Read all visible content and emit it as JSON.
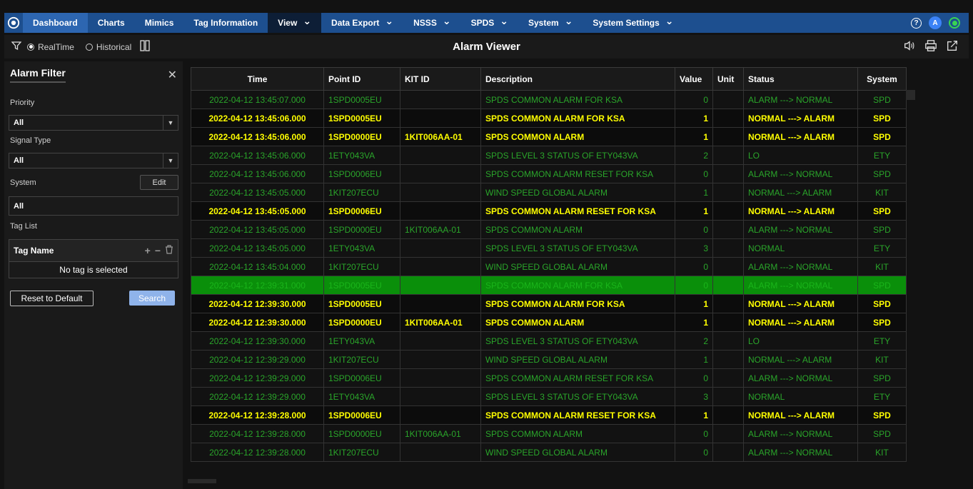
{
  "nav": {
    "items": [
      {
        "label": "Dashboard",
        "style": "active",
        "chevron": false
      },
      {
        "label": "Charts",
        "style": "",
        "chevron": false
      },
      {
        "label": "Mimics",
        "style": "",
        "chevron": false
      },
      {
        "label": "Tag Information",
        "style": "",
        "chevron": false
      },
      {
        "label": "View",
        "style": "dark",
        "chevron": true
      },
      {
        "label": "Data Export",
        "style": "",
        "chevron": true
      },
      {
        "label": "NSSS",
        "style": "",
        "chevron": true
      },
      {
        "label": "SPDS",
        "style": "",
        "chevron": true
      },
      {
        "label": "System",
        "style": "",
        "chevron": true
      },
      {
        "label": "System Settings",
        "style": "",
        "chevron": true
      }
    ],
    "avatar_letter": "A",
    "colors": {
      "bar": "#1d4f8f",
      "active": "#2d66b1",
      "status": "#39d353"
    }
  },
  "toolbar": {
    "realtime_label": "RealTime",
    "historical_label": "Historical",
    "title": "Alarm Viewer"
  },
  "filter": {
    "title": "Alarm Filter",
    "priority_label": "Priority",
    "priority_value": "All",
    "signal_type_label": "Signal Type",
    "signal_type_value": "All",
    "system_label": "System",
    "edit_label": "Edit",
    "system_value": "All",
    "tag_list_label": "Tag List",
    "tag_name_header": "Tag Name",
    "empty_text": "No tag is selected",
    "reset_label": "Reset to Default",
    "search_label": "Search"
  },
  "table": {
    "columns": [
      "Time",
      "Point ID",
      "KIT ID",
      "Description",
      "Value",
      "Unit",
      "Status",
      "System"
    ],
    "rows": [
      {
        "kind": "normal",
        "cells": [
          "2022-04-12 13:45:07.000",
          "1SPD0005EU",
          "",
          "SPDS COMMON ALARM FOR KSA",
          "0",
          "",
          "ALARM ---> NORMAL",
          "SPD"
        ]
      },
      {
        "kind": "alarm",
        "cells": [
          "2022-04-12 13:45:06.000",
          "1SPD0005EU",
          "",
          "SPDS COMMON ALARM FOR KSA",
          "1",
          "",
          "NORMAL ---> ALARM",
          "SPD"
        ]
      },
      {
        "kind": "alarm",
        "cells": [
          "2022-04-12 13:45:06.000",
          "1SPD0000EU",
          "1KIT006AA-01",
          "SPDS COMMON ALARM",
          "1",
          "",
          "NORMAL ---> ALARM",
          "SPD"
        ]
      },
      {
        "kind": "normal",
        "cells": [
          "2022-04-12 13:45:06.000",
          "1ETY043VA",
          "",
          "SPDS LEVEL 3 STATUS OF ETY043VA",
          "2",
          "",
          "LO",
          "ETY"
        ]
      },
      {
        "kind": "normal",
        "cells": [
          "2022-04-12 13:45:06.000",
          "1SPD0006EU",
          "",
          "SPDS COMMON ALARM RESET FOR KSA",
          "0",
          "",
          "ALARM ---> NORMAL",
          "SPD"
        ]
      },
      {
        "kind": "normal",
        "cells": [
          "2022-04-12 13:45:05.000",
          "1KIT207ECU",
          "",
          "WIND SPEED GLOBAL ALARM",
          "1",
          "",
          "NORMAL ---> ALARM",
          "KIT"
        ]
      },
      {
        "kind": "alarm",
        "cells": [
          "2022-04-12 13:45:05.000",
          "1SPD0006EU",
          "",
          "SPDS COMMON ALARM RESET FOR KSA",
          "1",
          "",
          "NORMAL ---> ALARM",
          "SPD"
        ]
      },
      {
        "kind": "normal",
        "cells": [
          "2022-04-12 13:45:05.000",
          "1SPD0000EU",
          "1KIT006AA-01",
          "SPDS COMMON ALARM",
          "0",
          "",
          "ALARM ---> NORMAL",
          "SPD"
        ]
      },
      {
        "kind": "normal",
        "cells": [
          "2022-04-12 13:45:05.000",
          "1ETY043VA",
          "",
          "SPDS LEVEL 3 STATUS OF ETY043VA",
          "3",
          "",
          "NORMAL",
          "ETY"
        ]
      },
      {
        "kind": "normal",
        "cells": [
          "2022-04-12 13:45:04.000",
          "1KIT207ECU",
          "",
          "WIND SPEED GLOBAL ALARM",
          "0",
          "",
          "ALARM ---> NORMAL",
          "KIT"
        ]
      },
      {
        "kind": "selected",
        "cells": [
          "2022-04-12 12:39:31.000",
          "1SPD0005EU",
          "",
          "SPDS COMMON ALARM FOR KSA",
          "0",
          "",
          "ALARM ---> NORMAL",
          "SPD"
        ]
      },
      {
        "kind": "alarm",
        "cells": [
          "2022-04-12 12:39:30.000",
          "1SPD0005EU",
          "",
          "SPDS COMMON ALARM FOR KSA",
          "1",
          "",
          "NORMAL ---> ALARM",
          "SPD"
        ]
      },
      {
        "kind": "alarm",
        "cells": [
          "2022-04-12 12:39:30.000",
          "1SPD0000EU",
          "1KIT006AA-01",
          "SPDS COMMON ALARM",
          "1",
          "",
          "NORMAL ---> ALARM",
          "SPD"
        ]
      },
      {
        "kind": "normal",
        "cells": [
          "2022-04-12 12:39:30.000",
          "1ETY043VA",
          "",
          "SPDS LEVEL 3 STATUS OF ETY043VA",
          "2",
          "",
          "LO",
          "ETY"
        ]
      },
      {
        "kind": "normal",
        "cells": [
          "2022-04-12 12:39:29.000",
          "1KIT207ECU",
          "",
          "WIND SPEED GLOBAL ALARM",
          "1",
          "",
          "NORMAL ---> ALARM",
          "KIT"
        ]
      },
      {
        "kind": "normal",
        "cells": [
          "2022-04-12 12:39:29.000",
          "1SPD0006EU",
          "",
          "SPDS COMMON ALARM RESET FOR KSA",
          "0",
          "",
          "ALARM ---> NORMAL",
          "SPD"
        ]
      },
      {
        "kind": "normal",
        "cells": [
          "2022-04-12 12:39:29.000",
          "1ETY043VA",
          "",
          "SPDS LEVEL 3 STATUS OF ETY043VA",
          "3",
          "",
          "NORMAL",
          "ETY"
        ]
      },
      {
        "kind": "alarm",
        "cells": [
          "2022-04-12 12:39:28.000",
          "1SPD0006EU",
          "",
          "SPDS COMMON ALARM RESET FOR KSA",
          "1",
          "",
          "NORMAL ---> ALARM",
          "SPD"
        ]
      },
      {
        "kind": "normal",
        "cells": [
          "2022-04-12 12:39:28.000",
          "1SPD0000EU",
          "1KIT006AA-01",
          "SPDS COMMON ALARM",
          "0",
          "",
          "ALARM ---> NORMAL",
          "SPD"
        ]
      },
      {
        "kind": "normal",
        "cells": [
          "2022-04-12 12:39:28.000",
          "1KIT207ECU",
          "",
          "WIND SPEED GLOBAL ALARM",
          "0",
          "",
          "ALARM ---> NORMAL",
          "KIT"
        ]
      }
    ],
    "colors": {
      "normal_text": "#2aa52a",
      "alarm_text": "#ffff00",
      "selected_bg": "#0a8f0a"
    }
  }
}
